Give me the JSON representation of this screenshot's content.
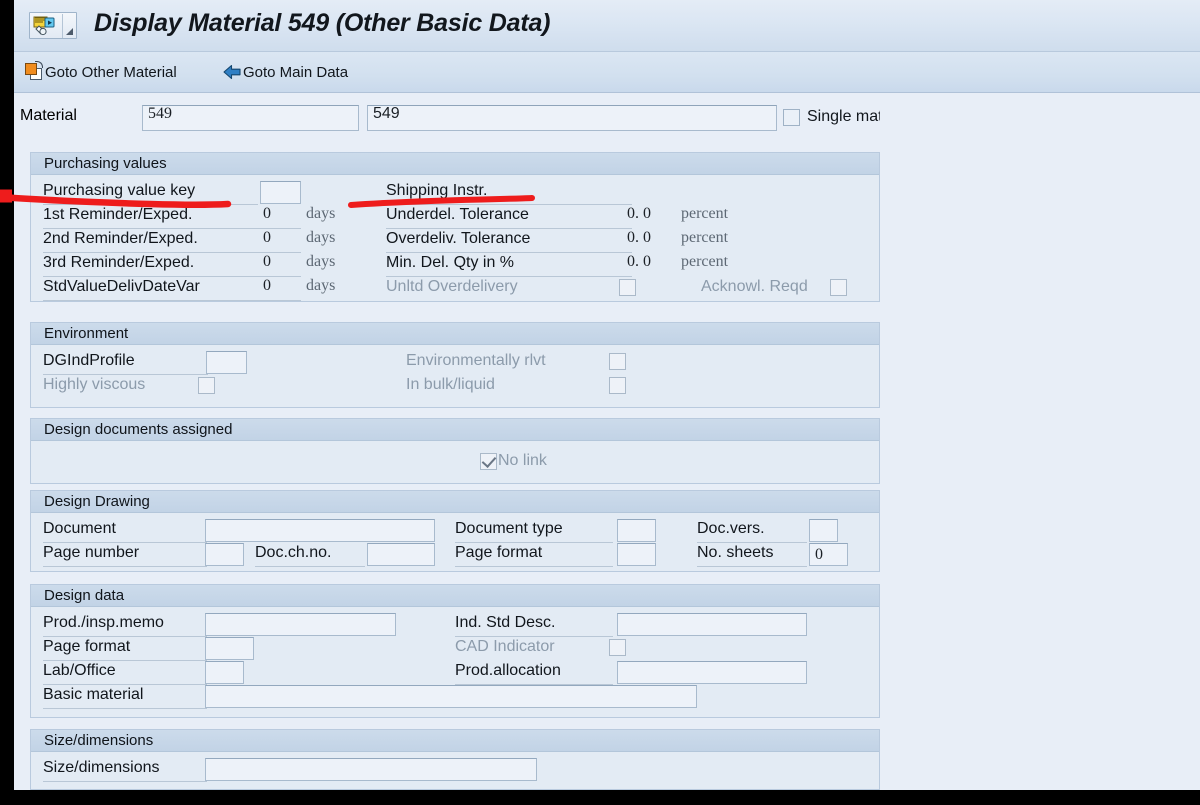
{
  "window": {
    "title": "Display Material 549 (Other Basic Data)",
    "system_icon": "sap-display-material-icon",
    "menu_arrow_icon": "dropdown-triangle-icon"
  },
  "toolbar": {
    "buttons": [
      {
        "label": "Goto Other Material",
        "icon": "copy-material-icon"
      },
      {
        "label": "Goto Main Data",
        "icon": "back-arrow-icon"
      }
    ]
  },
  "material_header": {
    "label": "Material",
    "key": "549",
    "description": "549",
    "single_material_label": "Single materi",
    "single_material_checked": false
  },
  "panels": {
    "purchasing": {
      "title": "Purchasing values",
      "left_rows": [
        {
          "label": "Purchasing value key",
          "value": "",
          "unit": "",
          "type": "input"
        },
        {
          "label": "1st Reminder/Exped.",
          "value": "0",
          "unit": "days",
          "type": "text"
        },
        {
          "label": "2nd Reminder/Exped.",
          "value": "0",
          "unit": "days",
          "type": "text"
        },
        {
          "label": "3rd Reminder/Exped.",
          "value": "0",
          "unit": "days",
          "type": "text"
        },
        {
          "label": "StdValueDelivDateVar",
          "value": "0",
          "unit": "days",
          "type": "text"
        }
      ],
      "right_rows": [
        {
          "label": "Shipping Instr.",
          "value": "",
          "unit": "",
          "type": "text",
          "disabled": false
        },
        {
          "label": "Underdel. Tolerance",
          "value": "0. 0",
          "unit": "percent",
          "type": "text",
          "disabled": false
        },
        {
          "label": "Overdeliv. Tolerance",
          "value": "0. 0",
          "unit": "percent",
          "type": "text",
          "disabled": false
        },
        {
          "label": "Min. Del. Qty in %",
          "value": "0. 0",
          "unit": "percent",
          "type": "text",
          "disabled": false
        },
        {
          "label": "Unltd Overdelivery",
          "value": "",
          "unit": "",
          "type": "checkbox",
          "checked": false,
          "disabled": true
        }
      ],
      "extra_checkbox": {
        "label": "Acknowl. Reqd",
        "checked": false,
        "disabled": true
      }
    },
    "environment": {
      "title": "Environment",
      "rows": [
        {
          "label": "DGIndProfile",
          "type": "input",
          "value": "",
          "disabled": false
        },
        {
          "label": "Highly viscous",
          "type": "checkbox",
          "checked": false,
          "disabled": true
        },
        {
          "label": "Environmentally rlvt",
          "type": "checkbox",
          "checked": false,
          "disabled": true
        },
        {
          "label": "In bulk/liquid",
          "type": "checkbox",
          "checked": false,
          "disabled": true
        }
      ]
    },
    "design_documents": {
      "title": "Design documents assigned",
      "no_link_label": "No link",
      "no_link_checked": true,
      "no_link_disabled": true
    },
    "design_drawing": {
      "title": "Design Drawing",
      "fields": [
        {
          "label": "Document",
          "value": ""
        },
        {
          "label": "Document type",
          "value": ""
        },
        {
          "label": "Doc.vers.",
          "value": ""
        },
        {
          "label": "Page number",
          "value": ""
        },
        {
          "label": "Doc.ch.no.",
          "value": ""
        },
        {
          "label": "Page format",
          "value": ""
        },
        {
          "label": "No. sheets",
          "value": "0"
        }
      ]
    },
    "design_data": {
      "title": "Design data",
      "fields": [
        {
          "label": "Prod./insp.memo",
          "value": "",
          "type": "input",
          "disabled": false
        },
        {
          "label": "Ind. Std Desc.",
          "value": "",
          "type": "input",
          "disabled": false
        },
        {
          "label": "Page format",
          "value": "",
          "type": "input",
          "disabled": false
        },
        {
          "label": "CAD Indicator",
          "value": "",
          "type": "checkbox",
          "checked": false,
          "disabled": true
        },
        {
          "label": "Lab/Office",
          "value": "",
          "type": "input",
          "disabled": false
        },
        {
          "label": "Prod.allocation",
          "value": "",
          "type": "input",
          "disabled": false
        },
        {
          "label": "Basic material",
          "value": "",
          "type": "input",
          "disabled": false
        }
      ]
    },
    "size_dimensions": {
      "title": "Size/dimensions",
      "field_label": "Size/dimensions",
      "value": ""
    }
  },
  "annotations": {
    "color": "#ee1c1c",
    "marks": [
      {
        "name": "underline-purchasing-value-key",
        "target": "Purchasing value key"
      },
      {
        "name": "underline-shipping-instr",
        "target": "Shipping Instr."
      }
    ]
  }
}
